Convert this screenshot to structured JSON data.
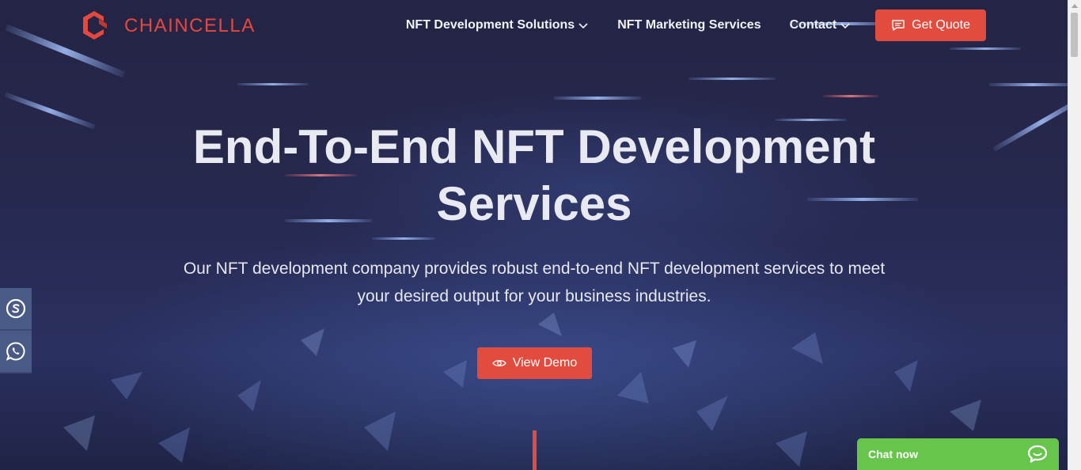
{
  "brand": {
    "name": "CHAINCELLA",
    "color": "#e6483d"
  },
  "nav": {
    "items": [
      {
        "label": "NFT Development Solutions",
        "has_dropdown": true
      },
      {
        "label": "NFT Marketing Services",
        "has_dropdown": false
      },
      {
        "label": "Contact",
        "has_dropdown": true
      }
    ],
    "quote_button": {
      "label": "Get Quote",
      "icon": "message-icon"
    }
  },
  "hero": {
    "title_line1": "End-To-End NFT Development",
    "title_line2": "Services",
    "subtitle": "Our NFT development company provides robust end-to-end NFT development services to meet your desired output for your business industries.",
    "demo_button": {
      "label": "View Demo",
      "icon": "eye-icon"
    }
  },
  "side_social": [
    {
      "icon": "skype-icon"
    },
    {
      "icon": "whatsapp-icon"
    }
  ],
  "chat": {
    "label": "Chat now",
    "icon": "chat-bubble-icon",
    "color": "#67c54c"
  },
  "colors": {
    "accent": "#e14c3f",
    "background": "#26284d",
    "text": "#e9e9f1"
  }
}
